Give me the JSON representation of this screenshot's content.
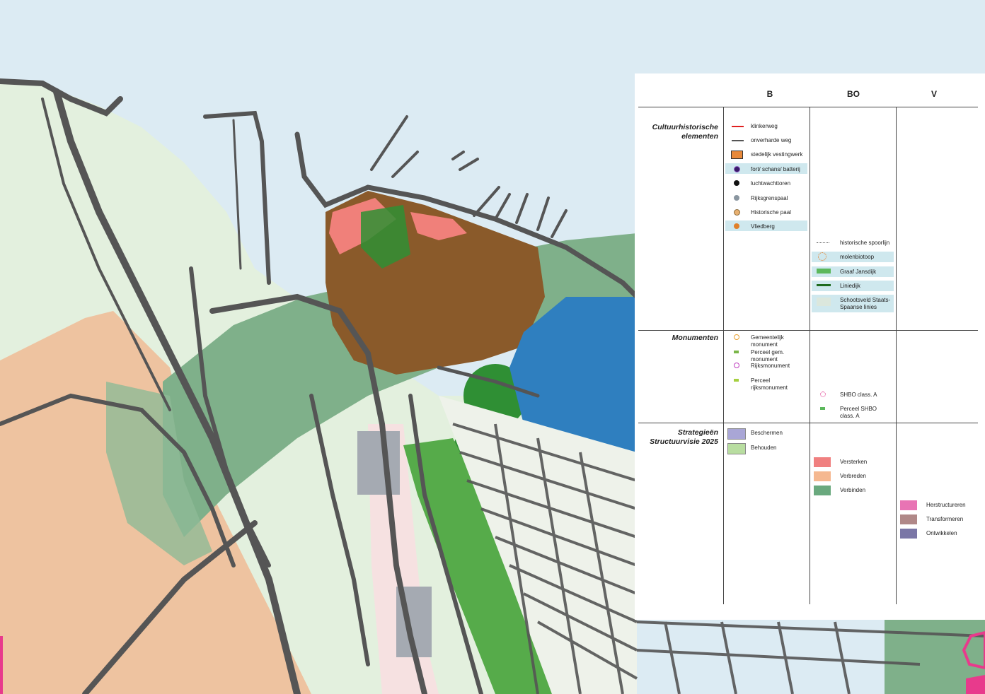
{
  "legend": {
    "columns": [
      "B",
      "BO",
      "V"
    ],
    "sections": {
      "cultuur": "Cultuurhistorische elementen",
      "monumenten": "Monumenten",
      "strategie": "Strategieën Structuurvisie 2025"
    },
    "items": {
      "klinkerweg": "klinkerweg",
      "onverhard": "onverharde weg",
      "vestingwerk": "stedelijk vestingwerk",
      "fort": "fort/ schans/ batterij",
      "luchtwacht": "luchtwachttoren",
      "rijksgrens": "Rijksgrenspaal",
      "hist_paal": "Historische paal",
      "vliedberg": "Vliedberg",
      "spoorlijn": "historische spoorlijn",
      "molen": "molenbiotoop",
      "jansdijk": "Graaf Jansdijk",
      "liniedijk": "Liniedijk",
      "schootsveld": "Schootsveld Staats- Spaanse linies",
      "gem_monument": "Gemeentelijk monument",
      "perceel_gem": "Perceel gem. monument",
      "rijksmonument": "Rijksmonument",
      "perceel_rijks": "Perceel rijksmonument",
      "shbo": "SHBO class. A",
      "perceel_shbo": "Perceel SHBO class. A",
      "beschermen": "Beschermen",
      "behouden": "Behouden",
      "versterken": "Versterken",
      "verbreden": "Verbreden",
      "verbinden": "Verbinden",
      "herstructureren": "Herstructureren",
      "transformeren": "Transformeren",
      "ontwikkelen": "Ontwikkelen"
    }
  },
  "colors": {
    "water": "#dcebf3",
    "light_green": "#e3f0de",
    "field": "#eec3a0",
    "verbinden": "#7fb08a",
    "historic_core": "#8a5a2a",
    "monument_green": "#3d9a3a",
    "residential_blue": "#2f7fbf",
    "roads": "#555555",
    "klinkerweg": "#e02020",
    "herstructureren": "#e874b4"
  }
}
